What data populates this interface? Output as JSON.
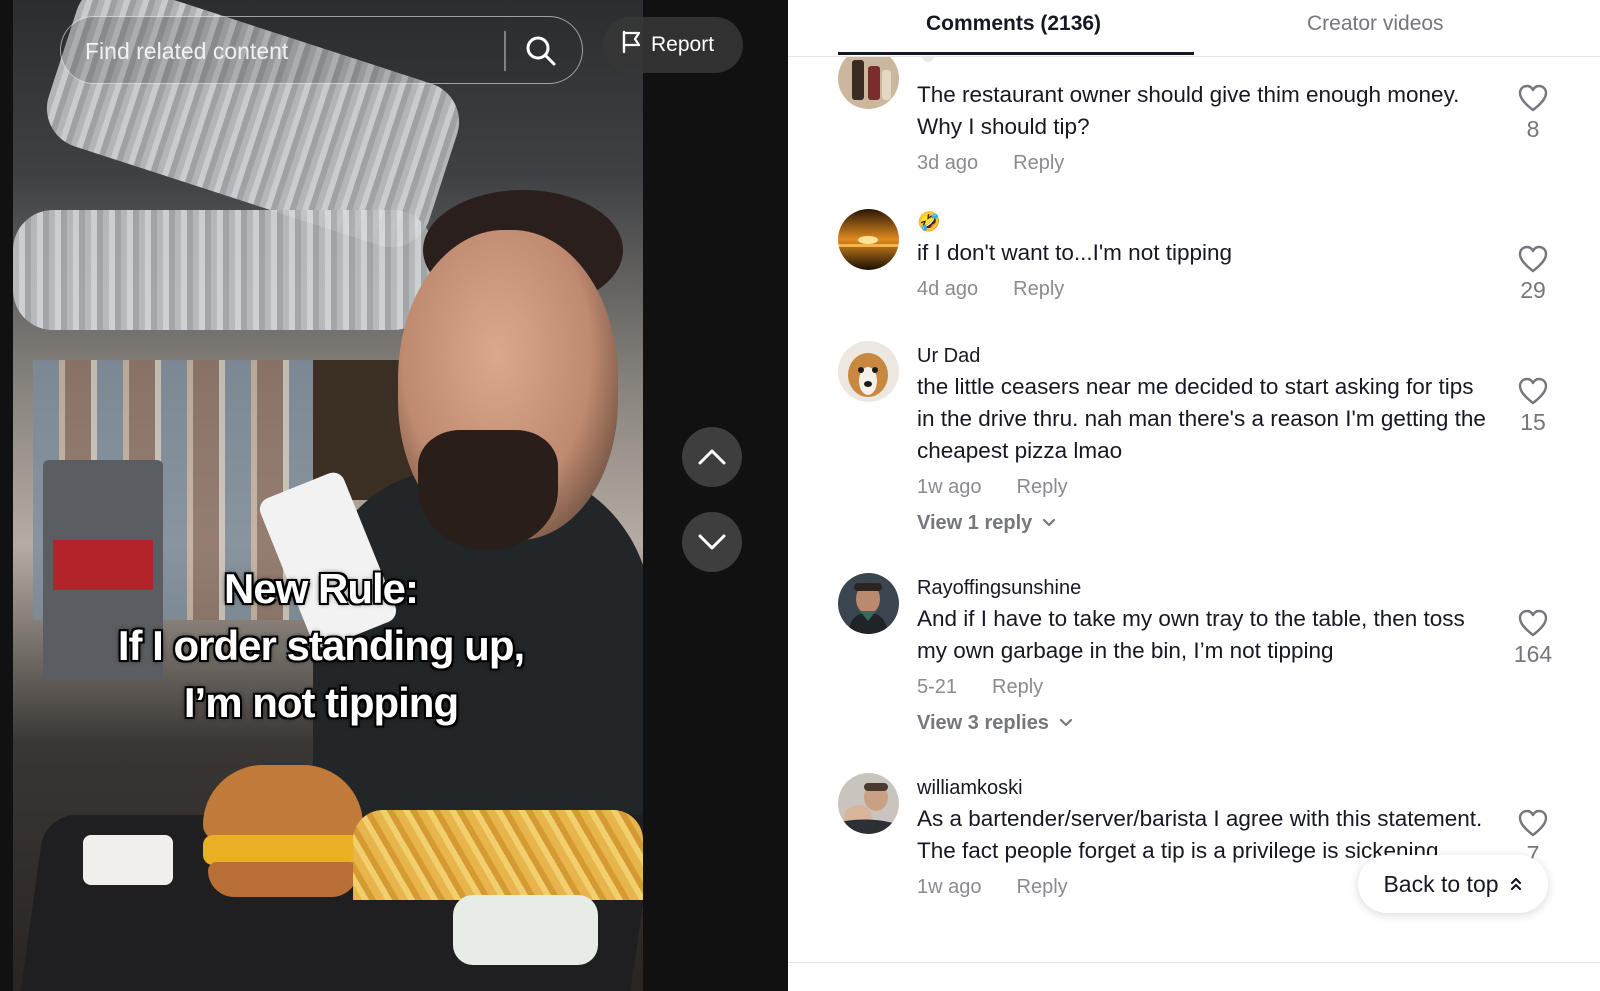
{
  "search": {
    "placeholder": "Find related content"
  },
  "report": {
    "label": "Report"
  },
  "video": {
    "caption_lines": [
      "New Rule:",
      "If I order standing up,",
      "I’m not tipping"
    ]
  },
  "tabs": [
    {
      "label": "Comments (2136)",
      "active": true
    },
    {
      "label": "Creator videos",
      "active": false
    }
  ],
  "comments": [
    {
      "username": "",
      "text": "The restaurant owner should give thim enough money. Why I should tip?",
      "time": "3d ago",
      "reply_label": "Reply",
      "likes": "8",
      "avatar": "bottles-avatar"
    },
    {
      "username": "🤣",
      "text": "if I don't want to...I'm not tipping",
      "time": "4d ago",
      "reply_label": "Reply",
      "likes": "29",
      "avatar": "sunset-avatar"
    },
    {
      "username": "Ur Dad",
      "text": "the little ceasers near me decided to start asking for tips in the drive thru. nah man there's a reason I'm getting the cheapest pizza lmao",
      "time": "1w ago",
      "reply_label": "Reply",
      "likes": "15",
      "view_replies": "View 1 reply",
      "avatar": "dog-avatar"
    },
    {
      "username": "Rayoffingsunshine",
      "text": "And if I have to take my own tray to the table, then toss my own garbage in the bin, I’m not tipping",
      "time": "5-21",
      "reply_label": "Reply",
      "likes": "164",
      "view_replies": "View 3 replies",
      "avatar": "man-avatar"
    },
    {
      "username": "williamkoski",
      "text": "As a bartender/server/barista I agree with this statement. The fact people forget a tip is a privilege is sickening.",
      "time": "1w ago",
      "reply_label": "Reply",
      "likes": "7",
      "avatar": "selfie-avatar"
    }
  ],
  "back_to_top": {
    "label": "Back to top"
  },
  "colors": {
    "text_primary": "#161823",
    "text_secondary": "#8a8b91",
    "panel_bg": "#ffffff"
  }
}
